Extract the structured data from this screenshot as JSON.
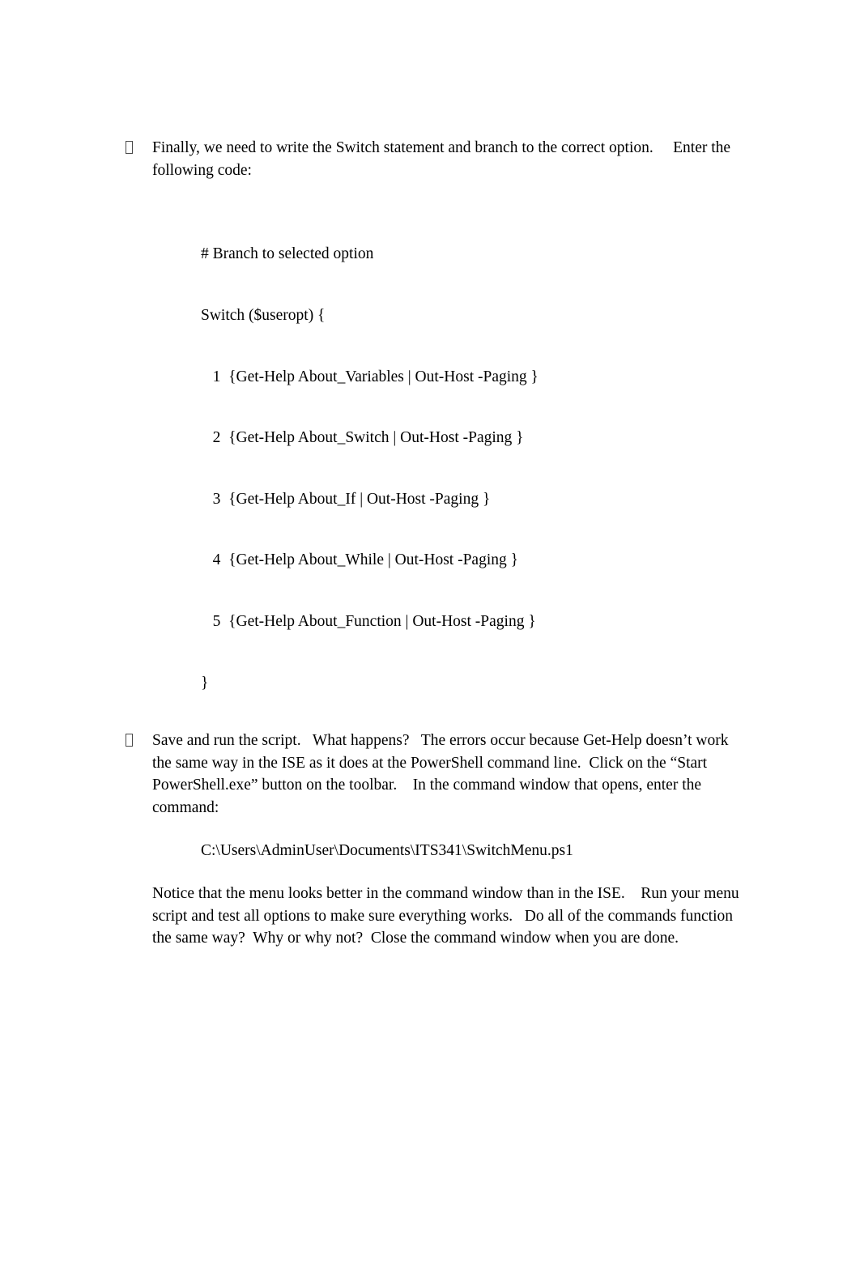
{
  "document": {
    "background_color": "#ffffff",
    "text_color": "#000000"
  },
  "bullets": [
    {
      "marker": "missing-glyph-box",
      "text": "Finally, we need to write the Switch statement and branch to the correct option.     Enter the following code:"
    },
    {
      "marker": "missing-glyph-box",
      "text": "Save and run the script.   What happens?   The errors occur because Get-Help doesn’t work the same way in the ISE as it does at the PowerShell command line.  Click on the “Start PowerShell.exe” button on the toolbar.    In the command window that opens, enter the command:"
    }
  ],
  "code_block": {
    "lines": [
      "# Branch to selected option",
      "Switch ($useropt) {",
      "   1  {Get-Help About_Variables | Out-Host -Paging }",
      "   2  {Get-Help About_Switch | Out-Host -Paging }",
      "   3  {Get-Help About_If | Out-Host -Paging }",
      "   4  {Get-Help About_While | Out-Host -Paging }",
      "   5  {Get-Help About_Function | Out-Host -Paging }",
      "}"
    ]
  },
  "command_path": {
    "value": "C:\\Users\\AdminUser\\Documents\\ITS341\\SwitchMenu.ps1"
  },
  "closing_paragraph": {
    "text": "Notice that the menu looks better in the command window than in the ISE.    Run your menu script and test all options to make sure everything works.   Do all of the commands function the same way?  Why or why not?  Close the command window when you are done."
  }
}
